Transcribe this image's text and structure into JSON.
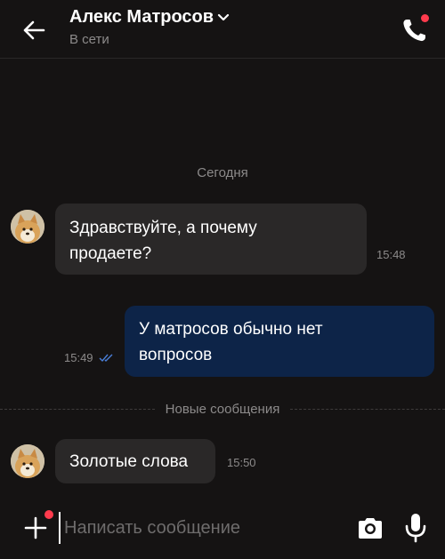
{
  "header": {
    "contact_name": "Алекс Матросов",
    "status": "В сети",
    "icons": {
      "back": "arrow-left-icon",
      "dropdown": "chevron-down-icon",
      "call": "phone-icon"
    }
  },
  "date_separator": "Сегодня",
  "messages": [
    {
      "direction": "incoming",
      "lines": [
        "Здравствуйте, а почему",
        "продаете?"
      ],
      "time": "15:48"
    },
    {
      "direction": "outgoing",
      "lines": [
        "У матросов обычно нет",
        "вопросов"
      ],
      "time": "15:49",
      "read": true
    },
    {
      "direction": "incoming",
      "lines": [
        "Золотые слова"
      ],
      "time": "15:50"
    }
  ],
  "new_messages_separator": "Новые сообщения",
  "composer": {
    "placeholder": "Написать сообщение",
    "icons": {
      "attach": "plus-icon",
      "camera": "camera-icon",
      "voice": "microphone-icon"
    }
  },
  "colors": {
    "background": "#151313",
    "incoming_bubble": "#2a2828",
    "outgoing_bubble": "#0d2448",
    "notification_dot": "#ff3b4d",
    "read_check": "#4a7fd9",
    "muted_text": "#8c8a8a"
  }
}
